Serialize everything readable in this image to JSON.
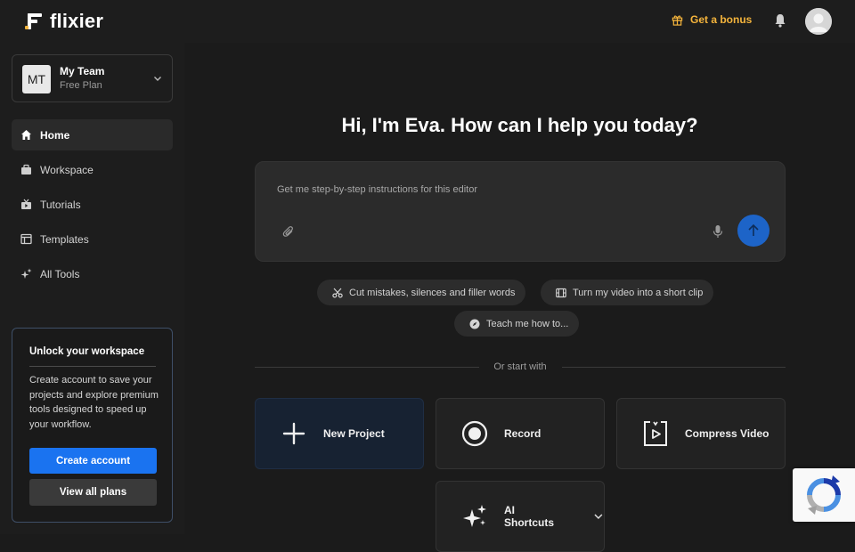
{
  "header": {
    "logo_text": "flixier",
    "bonus_label": "Get a bonus",
    "bell_icon": "bell-icon",
    "avatar_icon": "user-avatar-icon",
    "accent": "#f4b43c"
  },
  "sidebar": {
    "team": {
      "initials": "MT",
      "name": "My Team",
      "plan": "Free Plan"
    },
    "items": [
      {
        "label": "Home",
        "icon": "home-icon",
        "active": true
      },
      {
        "label": "Workspace",
        "icon": "briefcase-icon",
        "active": false
      },
      {
        "label": "Tutorials",
        "icon": "tv-icon",
        "active": false
      },
      {
        "label": "Templates",
        "icon": "layout-icon",
        "active": false
      },
      {
        "label": "All Tools",
        "icon": "sparkles-icon",
        "active": false
      }
    ],
    "unlock": {
      "title": "Unlock your workspace",
      "text": "Create account to save your projects and explore premium tools designed to speed up your workflow.",
      "create_label": "Create account",
      "plans_label": "View all plans"
    }
  },
  "main": {
    "greeting": "Hi, I'm Eva. How can I help you today?",
    "prompt_placeholder": "Get me step-by-step instructions for this editor",
    "suggestions": [
      {
        "label": "Cut mistakes, silences and filler words",
        "icon": "scissors-icon"
      },
      {
        "label": "Turn my video into a short clip",
        "icon": "film-icon"
      },
      {
        "label": "Teach me how to...",
        "icon": "compass-icon"
      }
    ],
    "or_start_with": "Or start with",
    "tiles": [
      {
        "label": "New Project",
        "icon": "plus-icon"
      },
      {
        "label": "Record",
        "icon": "record-icon"
      },
      {
        "label": "Compress Video",
        "icon": "compress-video-icon"
      },
      {
        "label": "AI Shortcuts",
        "icon": "ai-sparkles-icon"
      }
    ]
  },
  "colors": {
    "primary_button": "#1a73f0",
    "send_button": "#1d64c8",
    "background": "#1b1b1b"
  }
}
